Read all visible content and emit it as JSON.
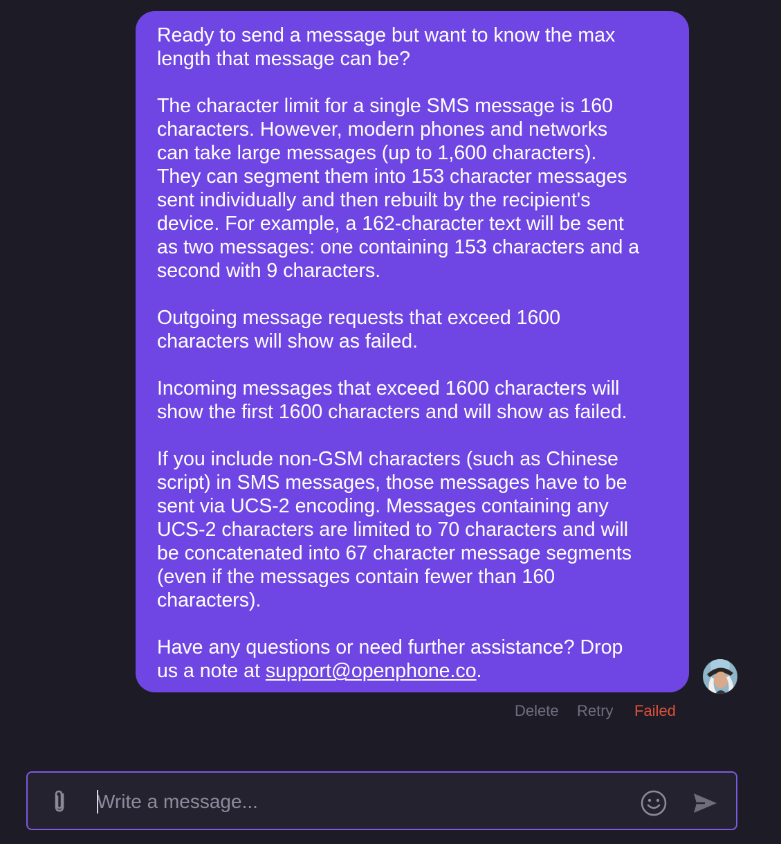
{
  "message": {
    "paragraphs": [
      "Ready to send a message but want to know the max\nlength that message can be?",
      "The character limit for a single SMS message is 160\ncharacters. However, modern phones and networks\ncan take large messages (up to 1,600 characters).\nThey can segment them into 153 character messages\nsent individually and then rebuilt by the recipient's\ndevice. For example, a 162-character text will be sent\nas two messages: one containing 153 characters and a\nsecond with 9 characters.",
      "Outgoing message requests that exceed 1600\ncharacters will show as failed.",
      "Incoming messages that exceed 1600 characters will\nshow the first 1600 characters and will show as failed.",
      "If you include non-GSM characters (such as Chinese\nscript) in SMS messages, those messages have to be\nsent via UCS-2 encoding. Messages containing any\nUCS-2 characters are limited to 70 characters and will\nbe concatenated into 67 character message segments\n(even if the messages contain fewer than 160\ncharacters)."
    ],
    "closing_prefix": "Have any questions or need further assistance? Drop\nus a note at ",
    "email": "support@openphone.co",
    "closing_suffix": "."
  },
  "actions": {
    "delete_label": "Delete",
    "retry_label": "Retry",
    "status_label": "Failed"
  },
  "composer": {
    "placeholder": "Write a message...",
    "value": ""
  },
  "icons": {
    "attach": "paperclip-icon",
    "emoji": "smiley-icon",
    "send": "send-icon",
    "avatar": "user-avatar"
  },
  "colors": {
    "background": "#1d1c26",
    "bubble": "#6f46e3",
    "failed": "#e0513a",
    "muted_action": "#6f6e80",
    "composer_border": "#7a5ae0"
  }
}
